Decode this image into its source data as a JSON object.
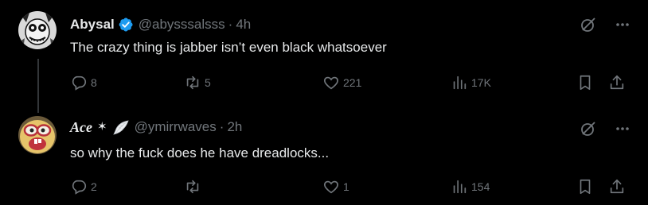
{
  "tweets": [
    {
      "name": "Abysal",
      "verified": true,
      "handle": "@abysssalsss",
      "separator": "·",
      "time": "4h",
      "text": "The crazy thing is jabber isn’t even black whatsoever",
      "replies": "8",
      "reposts": "5",
      "likes": "221",
      "views": "17K"
    },
    {
      "name": "Ace",
      "name_star": "✶",
      "handle": "@ymirrwaves",
      "separator": "·",
      "time": "2h",
      "text": "so why the fuck does he have dreadlocks...",
      "replies": "2",
      "reposts": "",
      "likes": "1",
      "views": "154"
    }
  ],
  "colors": {
    "background": "#000000",
    "text": "#e7e9ea",
    "muted": "#71767b",
    "verified": "#1d9bf0",
    "thread_line": "#333639"
  },
  "icons": [
    "grok-icon",
    "more-icon",
    "reply-icon",
    "repost-icon",
    "like-icon",
    "views-icon",
    "bookmark-icon",
    "share-icon",
    "verified-badge-icon",
    "wing-emoji-icon"
  ]
}
